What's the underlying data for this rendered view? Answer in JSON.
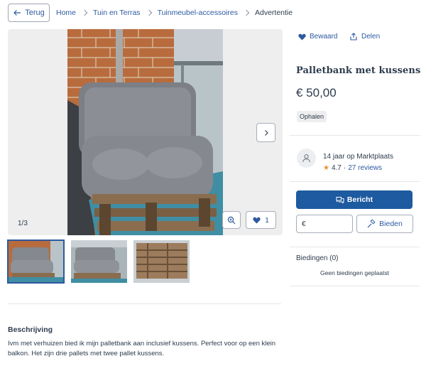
{
  "nav": {
    "back_label": "Terug",
    "breadcrumb": [
      "Home",
      "Tuin en Terras",
      "Tuinmeubel-accessoires",
      "Advertentie"
    ]
  },
  "gallery": {
    "counter": "1/3",
    "favorite_count": "1",
    "thumbnails": [
      "pallet-bench-with-cushions",
      "pallet-bench-side-view",
      "bare-pallets"
    ]
  },
  "actions": {
    "save_label": "Bewaard",
    "share_label": "Delen"
  },
  "listing": {
    "title": "Palletbank met kussens",
    "price": "€ 50,00",
    "delivery_badge": "Ophalen"
  },
  "seller": {
    "years": "14 jaar op Marktplaats",
    "rating": "4.7",
    "separator": "·",
    "reviews": "27 reviews"
  },
  "contact": {
    "message_label": "Bericht",
    "bid_currency": "€",
    "bid_label": "Bieden"
  },
  "bids": {
    "title": "Biedingen (0)",
    "empty": "Geen biedingen geplaatst"
  },
  "description": {
    "title": "Beschrijving",
    "text": "Ivm met verhuizen bied ik mijn palletbank aan inclusief kussens. Perfect voor op een klein balkon. Het zijn drie pallets met twee pallet kussens."
  },
  "colors": {
    "accent": "#1e5aa0",
    "link": "#2d5aa0",
    "text": "#2d3c4d",
    "star": "#e5922a"
  }
}
